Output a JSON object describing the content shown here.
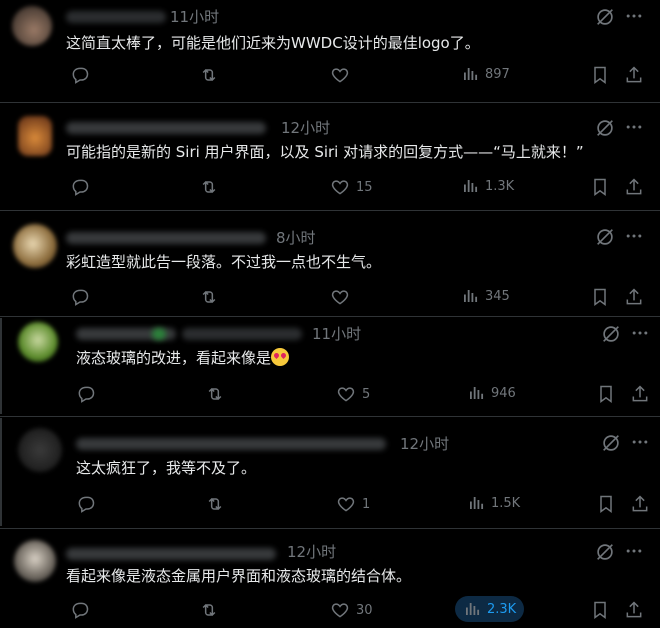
{
  "posts": [
    {
      "time": "11小时",
      "text": "这简直太棒了，可能是他们近来为WWDC设计的最佳logo了。",
      "likes": "",
      "views": "897"
    },
    {
      "time": "12小时",
      "text": "可能指的是新的 Siri 用户界面，以及 Siri 对请求的回复方式——“马上就来！”",
      "likes": "15",
      "views": "1.3K"
    },
    {
      "time": "8小时",
      "text": "彩虹造型就此告一段落。不过我一点也不生气。",
      "likes": "",
      "views": "345"
    },
    {
      "time": "11小时",
      "text": "液态玻璃的改进，看起来像是",
      "likes": "5",
      "views": "946"
    },
    {
      "time": "12小时",
      "text": "这太疯狂了，我等不及了。",
      "likes": "1",
      "views": "1.5K"
    },
    {
      "time": "12小时",
      "text": "看起来像是液态金属用户界面和液态玻璃的结合体。",
      "likes": "30",
      "views": "2.3K"
    }
  ],
  "icons": {
    "grok": "grok-icon",
    "more": "more-icon",
    "reply": "reply-icon",
    "repost": "repost-icon",
    "like": "heart-icon",
    "views": "views-icon",
    "bookmark": "bookmark-icon",
    "share": "share-icon"
  },
  "colors": {
    "background": "#000000",
    "muted": "#71767b",
    "text": "#e7e9ea",
    "accent": "#1d9bf0"
  }
}
